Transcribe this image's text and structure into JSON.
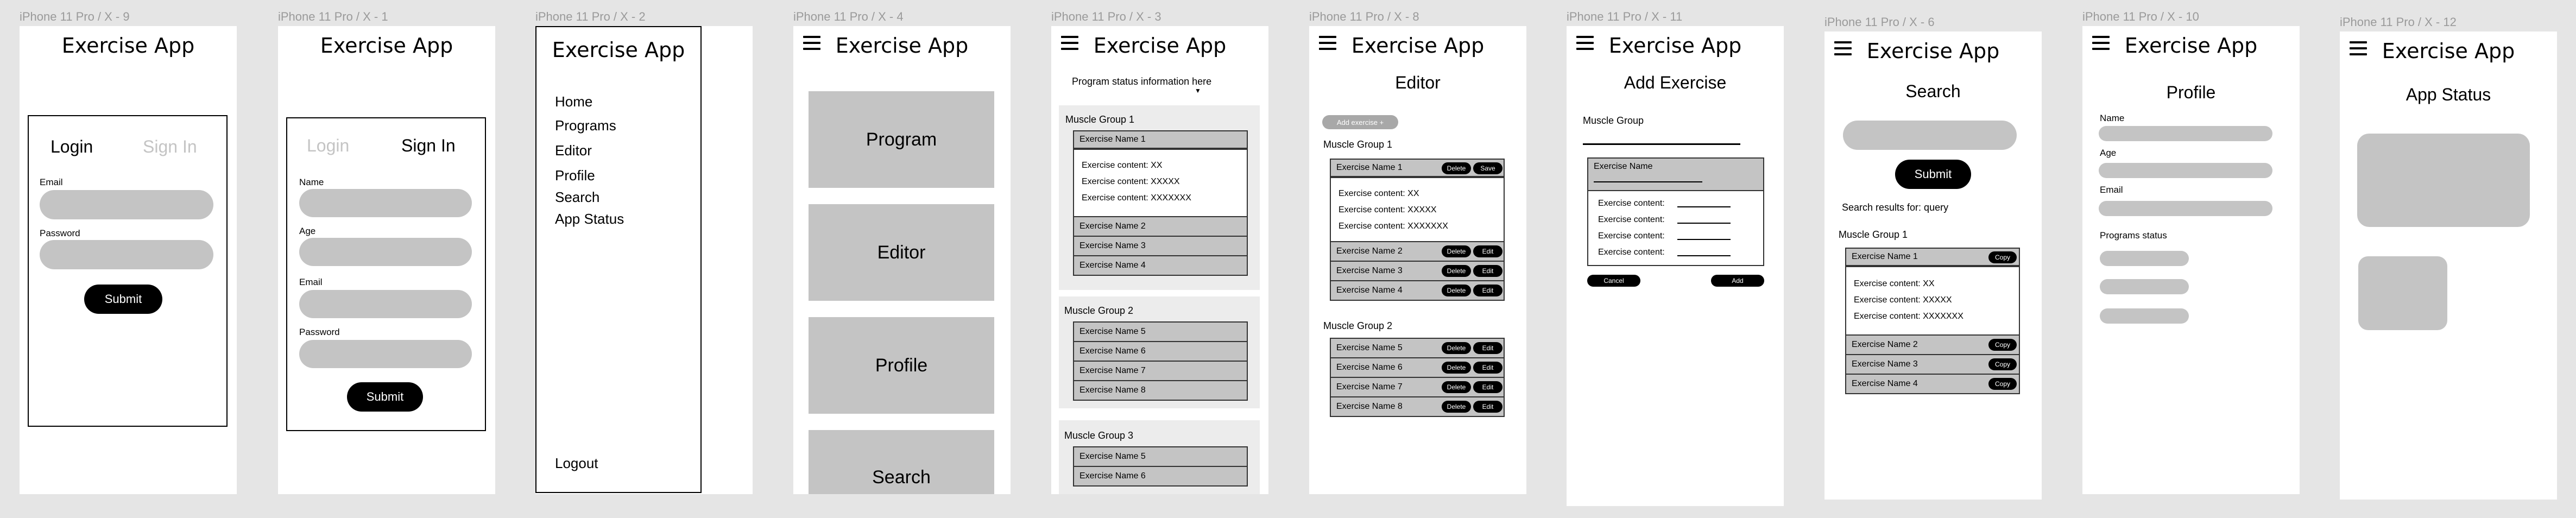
{
  "labels": {
    "f1": "iPhone 11 Pro / X - 9",
    "f2": "iPhone 11 Pro / X - 1",
    "f3": "iPhone 11 Pro / X - 2",
    "f4": "iPhone 11 Pro / X - 4",
    "f5": "iPhone 11 Pro / X - 3",
    "f6": "iPhone 11 Pro / X - 8",
    "f7": "iPhone 11 Pro / X - 11",
    "f8": "iPhone 11 Pro / X - 6",
    "f9": "iPhone 11 Pro / X - 10",
    "f10": "iPhone 11 Pro / X - 12"
  },
  "app_title": "Exercise App",
  "login": {
    "tab_login": "Login",
    "tab_signin": "Sign In",
    "email": "Email",
    "password": "Password",
    "submit": "Submit"
  },
  "signin": {
    "tab_login": "Login",
    "tab_signin": "Sign In",
    "name": "Name",
    "age": "Age",
    "email": "Email",
    "password": "Password",
    "submit": "Submit"
  },
  "menu": {
    "items": [
      "Home",
      "Programs",
      "Editor",
      "Profile",
      "Search",
      "App Status"
    ],
    "logout": "Logout"
  },
  "home": {
    "buttons": [
      "Program",
      "Editor",
      "Profile",
      "Search"
    ]
  },
  "program": {
    "status": "Program status information here",
    "groups": [
      "Muscle Group 1",
      "Muscle Group 2",
      "Muscle Group 3"
    ],
    "g1": [
      "Exercise Name 1",
      "Exercise Name 2",
      "Exercise Name 3",
      "Exercise Name 4"
    ],
    "g2": [
      "Exercise Name 5",
      "Exercise Name 6",
      "Exercise Name 7",
      "Exercise Name 8"
    ],
    "g3": [
      "Exercise Name 5",
      "Exercise Name 6"
    ],
    "content": [
      "Exercise content: XX",
      "Exercise content: XXXXX",
      "Exercise content: XXXXXXX"
    ]
  },
  "editor": {
    "title": "Editor",
    "add_exercise": "Add exercise +",
    "groups": [
      "Muscle Group 1",
      "Muscle Group 2"
    ],
    "g1": [
      "Exercise Name 1",
      "Exercise Name 2",
      "Exercise Name 3",
      "Exercise Name 4"
    ],
    "g2": [
      "Exercise Name 5",
      "Exercise Name 6",
      "Exercise Name 7",
      "Exercise Name 8"
    ],
    "content": [
      "Exercise content: XX",
      "Exercise content: XXXXX",
      "Exercise content: XXXXXXX"
    ],
    "delete": "Delete",
    "save": "Save",
    "edit": "Edit"
  },
  "add": {
    "title": "Add Exercise",
    "muscle_group": "Muscle Group",
    "exercise_name": "Exercise Name",
    "content_label": "Exercise content:",
    "cancel": "Cancel",
    "add": "Add"
  },
  "search": {
    "title": "Search",
    "submit": "Submit",
    "results": "Search results for: query",
    "group": "Muscle Group 1",
    "rows": [
      "Exercise Name 1",
      "Exercise Name 2",
      "Exercise Name 3",
      "Exercise Name 4"
    ],
    "content": [
      "Exercise content: XX",
      "Exercise content: XXXXX",
      "Exercise content: XXXXXXX"
    ],
    "copy": "Copy"
  },
  "profile": {
    "title": "Profile",
    "name": "Name",
    "age": "Age",
    "email": "Email",
    "programs_status": "Programs status"
  },
  "status": {
    "title": "App Status"
  }
}
